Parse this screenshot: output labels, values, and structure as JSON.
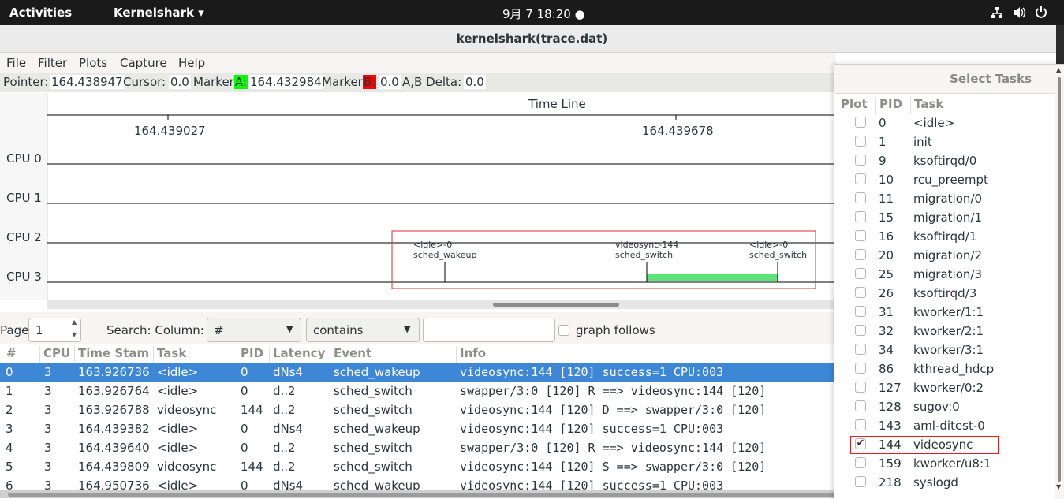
{
  "topbar": {
    "activities": "Activities",
    "app": "Kernelshark",
    "clock": "9月 7  18:20"
  },
  "window": {
    "title": "kernelshark(trace.dat)"
  },
  "menu": [
    "File",
    "Filter",
    "Plots",
    "Capture",
    "Help"
  ],
  "info": {
    "pointer_label": "Pointer:",
    "pointer": "164.438947",
    "cursor_label": "Cursor:",
    "cursor": "0.0",
    "markerA_label": "Marker",
    "markerA_tag": "A:",
    "markerA": "164.432984",
    "markerB_label": "Marker",
    "markerB_tag": "B:",
    "markerB": "0.0",
    "delta_label": "A,B Delta:",
    "delta": "0.0",
    "markerA_color": "#00ff00",
    "markerB_color": "#ff0000"
  },
  "graph": {
    "title": "Time Line",
    "tick1": "164.439027",
    "tick2": "164.439678",
    "cpus": [
      "CPU 0",
      "CPU 1",
      "CPU 2",
      "CPU 3"
    ],
    "events": [
      {
        "line1": "<idle>-0",
        "line2": "sched_wakeup"
      },
      {
        "line1": "videosync-144",
        "line2": "sched_switch"
      },
      {
        "line1": "<idle>-0",
        "line2": "sched_switch"
      }
    ],
    "task_color": "#5ee37a",
    "highlight_color": "#d93030"
  },
  "controls": {
    "page_label": "Page",
    "page_value": "1",
    "search_label": "Search: Column:",
    "column_value": "#",
    "match_value": "contains",
    "search_value": "",
    "graph_follows": "graph follows"
  },
  "table": {
    "headers": [
      "#",
      "CPU",
      "Time Stam",
      "Task",
      "PID",
      "Latency",
      "Event",
      "Info"
    ],
    "rows": [
      [
        "0",
        "3",
        "163.926736",
        "<idle>",
        "0",
        "dNs4",
        "sched_wakeup",
        "videosync:144 [120] success=1 CPU:003"
      ],
      [
        "1",
        "3",
        "163.926764",
        "<idle>",
        "0",
        "d..2",
        "sched_switch",
        "swapper/3:0 [120] R ==> videosync:144 [120]"
      ],
      [
        "2",
        "3",
        "163.926788",
        "videosync",
        "144",
        "d..2",
        "sched_switch",
        "videosync:144 [120] D ==> swapper/3:0 [120]"
      ],
      [
        "3",
        "3",
        "164.439382",
        "<idle>",
        "0",
        "dNs4",
        "sched_wakeup",
        "videosync:144 [120] success=1 CPU:003"
      ],
      [
        "4",
        "3",
        "164.439640",
        "<idle>",
        "0",
        "d..2",
        "sched_switch",
        "swapper/3:0 [120] R ==> videosync:144 [120]"
      ],
      [
        "5",
        "3",
        "164.439809",
        "videosync",
        "144",
        "d..2",
        "sched_switch",
        "videosync:144 [120] S ==> swapper/3:0 [120]"
      ],
      [
        "6",
        "3",
        "164.950736",
        "<idle>",
        "0",
        "dNs4",
        "sched_wakeup",
        "videosync:144 [120] success=1 CPU:003"
      ]
    ]
  },
  "dialog": {
    "title": "Select Tasks",
    "headers": [
      "Plot",
      "PID",
      "Task"
    ],
    "tasks": [
      {
        "pid": "0",
        "name": "<idle>",
        "checked": false
      },
      {
        "pid": "1",
        "name": "init",
        "checked": false
      },
      {
        "pid": "9",
        "name": "ksoftirqd/0",
        "checked": false
      },
      {
        "pid": "10",
        "name": "rcu_preempt",
        "checked": false
      },
      {
        "pid": "11",
        "name": "migration/0",
        "checked": false
      },
      {
        "pid": "15",
        "name": "migration/1",
        "checked": false
      },
      {
        "pid": "16",
        "name": "ksoftirqd/1",
        "checked": false
      },
      {
        "pid": "20",
        "name": "migration/2",
        "checked": false
      },
      {
        "pid": "25",
        "name": "migration/3",
        "checked": false
      },
      {
        "pid": "26",
        "name": "ksoftirqd/3",
        "checked": false
      },
      {
        "pid": "31",
        "name": "kworker/1:1",
        "checked": false
      },
      {
        "pid": "32",
        "name": "kworker/2:1",
        "checked": false
      },
      {
        "pid": "34",
        "name": "kworker/3:1",
        "checked": false
      },
      {
        "pid": "86",
        "name": "kthread_hdcp",
        "checked": false
      },
      {
        "pid": "127",
        "name": "kworker/0:2",
        "checked": false
      },
      {
        "pid": "128",
        "name": "sugov:0",
        "checked": false
      },
      {
        "pid": "143",
        "name": "aml-ditest-0",
        "checked": false
      },
      {
        "pid": "144",
        "name": "videosync",
        "checked": true
      },
      {
        "pid": "159",
        "name": "kworker/u8:1",
        "checked": false
      },
      {
        "pid": "218",
        "name": "syslogd",
        "checked": false
      }
    ]
  }
}
